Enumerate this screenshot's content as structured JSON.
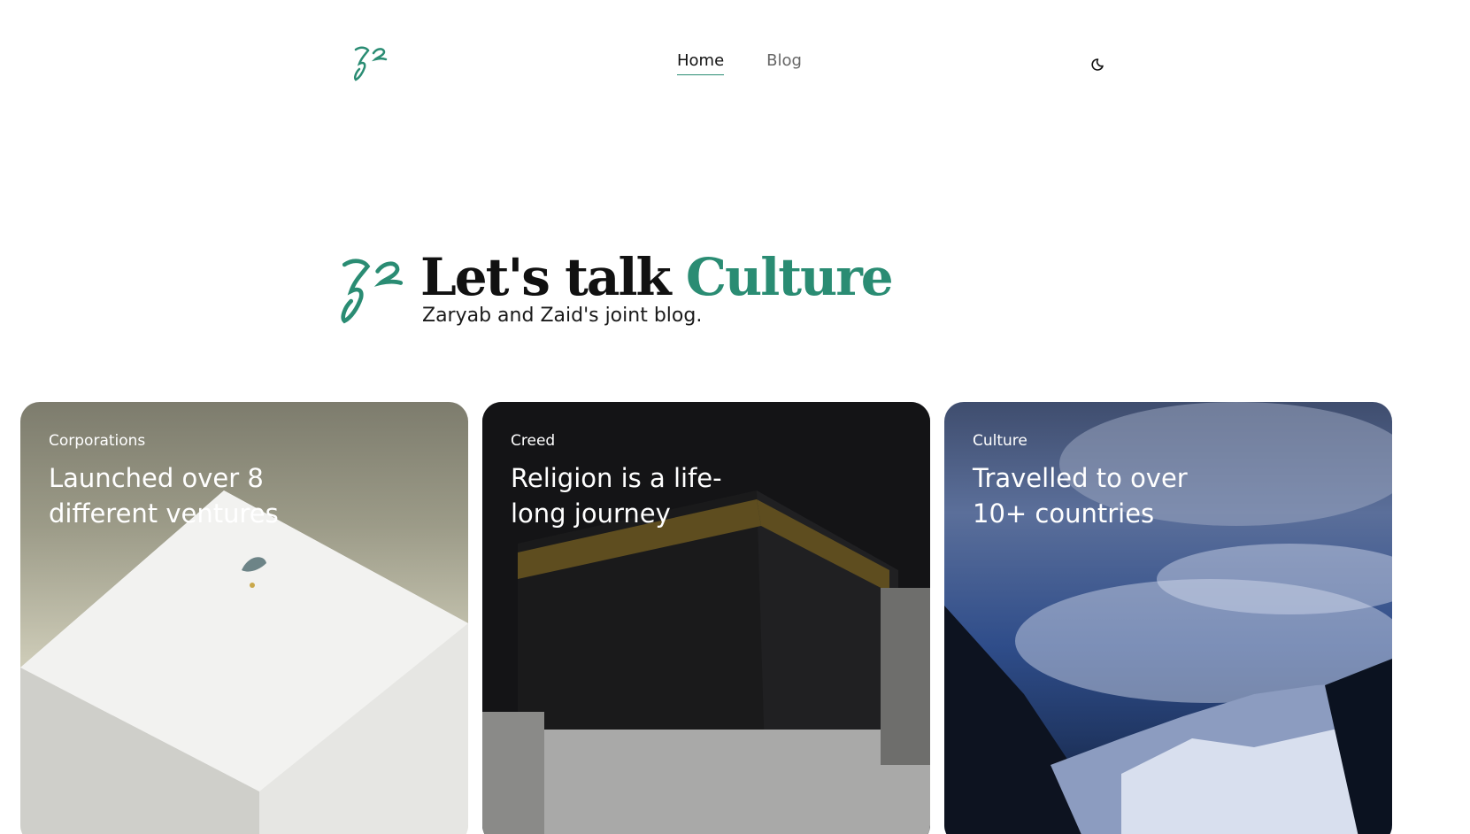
{
  "header": {
    "logo_icon": "zz-monogram-icon",
    "nav": [
      {
        "label": "Home",
        "active": true
      },
      {
        "label": "Blog",
        "active": false
      }
    ],
    "theme_toggle_icon": "moon-icon"
  },
  "hero": {
    "title_prefix": "Let's talk",
    "title_accent": "Culture",
    "subtitle": "Zaryab and Zaid's joint blog.",
    "accent_color": "#2a8c73"
  },
  "cards": [
    {
      "category": "Corporations",
      "title": "Launched over 8 different ventures",
      "image": "ghazal-perfume-box"
    },
    {
      "category": "Creed",
      "title": "Religion is a life-long journey",
      "image": "kaaba-pilgrims"
    },
    {
      "category": "Culture",
      "title": "Travelled to over 10+ countries",
      "image": "mountain-clouds"
    }
  ]
}
